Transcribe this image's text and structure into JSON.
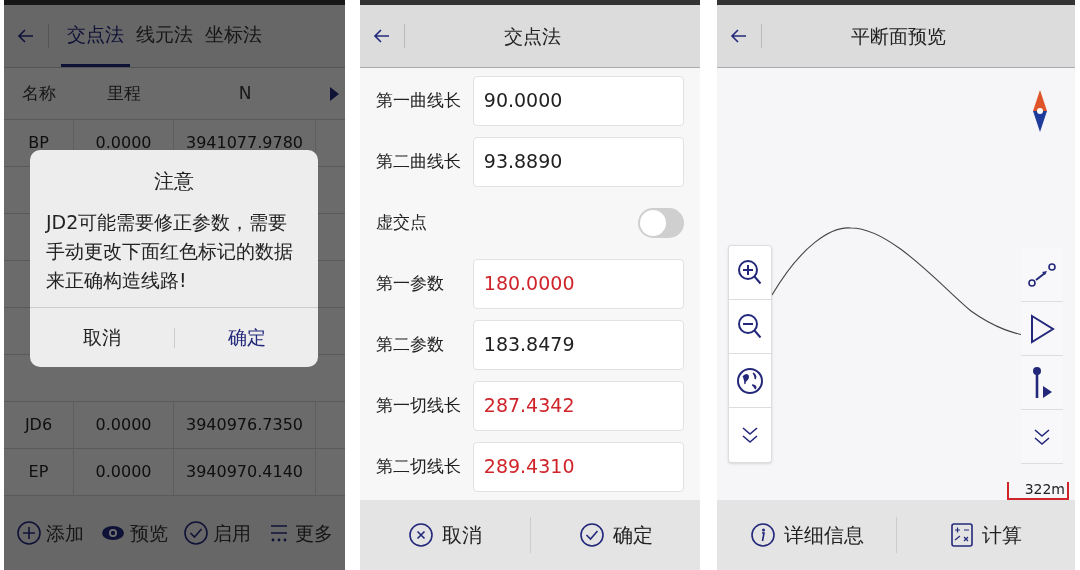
{
  "list_screen": {
    "tabs": [
      {
        "label": "交点法",
        "selected": true
      },
      {
        "label": "线元法",
        "selected": false
      },
      {
        "label": "坐标法",
        "selected": false
      }
    ],
    "table": {
      "columns": [
        "名称",
        "里程",
        "N"
      ],
      "rows": [
        {
          "cells": [
            "BP",
            "0.0000",
            "3941077.9780"
          ]
        },
        {
          "cells": [
            "JD6",
            "0.0000",
            "3940976.7350"
          ]
        },
        {
          "cells": [
            "EP",
            "0.0000",
            "3940970.4140"
          ]
        }
      ]
    },
    "dialog": {
      "title": "注意",
      "message": "JD2可能需要修正参数，需要手动更改下面红色标记的数据来正确构造线路!",
      "buttons": [
        {
          "label": "取消",
          "primary": false
        },
        {
          "label": "确定",
          "primary": true
        }
      ]
    },
    "bottom_bar": [
      {
        "label": "添加"
      },
      {
        "label": "预览"
      },
      {
        "label": "启用"
      },
      {
        "label": "更多"
      }
    ]
  },
  "form_screen": {
    "title": "交点法",
    "fields": [
      {
        "kind": "input",
        "label": "第一曲线长",
        "value": "90.0000",
        "highlighted": false
      },
      {
        "kind": "input",
        "label": "第二曲线长",
        "value": "93.8890",
        "highlighted": false
      },
      {
        "kind": "toggle",
        "label": "虚交点",
        "on": false
      },
      {
        "kind": "input",
        "label": "第一参数",
        "value": "180.0000",
        "highlighted": true
      },
      {
        "kind": "input",
        "label": "第二参数",
        "value": "183.8479",
        "highlighted": false
      },
      {
        "kind": "input",
        "label": "第一切线长",
        "value": "287.4342",
        "highlighted": true
      },
      {
        "kind": "input",
        "label": "第二切线长",
        "value": "289.4310",
        "highlighted": true
      }
    ],
    "buttons": [
      {
        "label": "取消"
      },
      {
        "label": "确定"
      }
    ]
  },
  "preview_screen": {
    "title": "平断面预览",
    "scale": "322m",
    "buttons": [
      {
        "label": "详细信息"
      },
      {
        "label": "计算"
      }
    ]
  }
}
